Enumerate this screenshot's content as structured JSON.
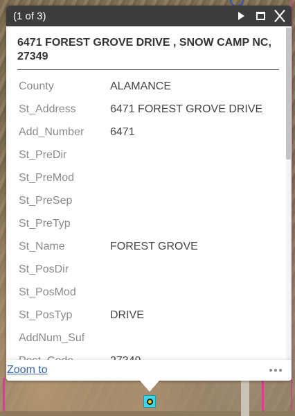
{
  "header": {
    "page_count": "(1 of 3)"
  },
  "popup": {
    "title": "6471 FOREST GROVE DRIVE , SNOW CAMP NC, 27349",
    "attributes": [
      {
        "key": "County",
        "value": "ALAMANCE"
      },
      {
        "key": "St_Address",
        "value": "6471 FOREST GROVE DRIVE"
      },
      {
        "key": "Add_Number",
        "value": "6471"
      },
      {
        "key": "St_PreDir",
        "value": ""
      },
      {
        "key": "St_PreMod",
        "value": ""
      },
      {
        "key": "St_PreSep",
        "value": ""
      },
      {
        "key": "St_PreTyp",
        "value": ""
      },
      {
        "key": "St_Name",
        "value": "FOREST GROVE"
      },
      {
        "key": "St_PosDir",
        "value": ""
      },
      {
        "key": "St_PosMod",
        "value": ""
      },
      {
        "key": "St_PosTyp",
        "value": "DRIVE"
      },
      {
        "key": "AddNum_Suf",
        "value": ""
      },
      {
        "key": "Post_Code",
        "value": "27349"
      }
    ]
  },
  "footer": {
    "zoom_label": "Zoom to"
  },
  "icons": {
    "next": "play-icon",
    "maximize": "maximize-icon",
    "close": "close-icon",
    "more": "more-icon"
  }
}
